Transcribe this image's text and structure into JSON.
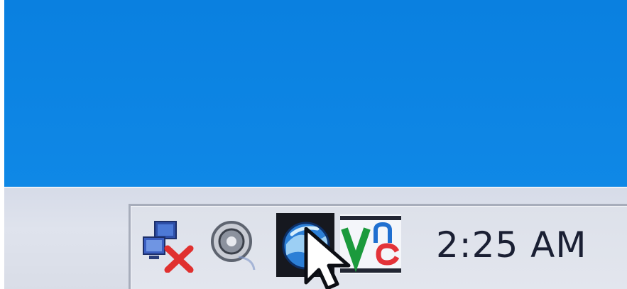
{
  "desktop": {
    "background_color": "#0f88e6"
  },
  "taskbar": {
    "tray_icons": [
      {
        "name": "network-disconnected-icon"
      },
      {
        "name": "volume-icon"
      },
      {
        "name": "web-globe-icon"
      },
      {
        "name": "vnc-icon"
      }
    ],
    "clock": {
      "time": "2:25 AM"
    }
  },
  "cursor": {
    "name": "mouse-pointer-icon"
  },
  "colors": {
    "taskbar": "#dce0ea",
    "tray_border": "#a7adbb",
    "clock_text": "#1a1f33",
    "error_x": "#e0302f",
    "vnc_green": "#1b9a3c",
    "vnc_blue": "#1f6fd0",
    "vnc_red": "#e33339"
  }
}
